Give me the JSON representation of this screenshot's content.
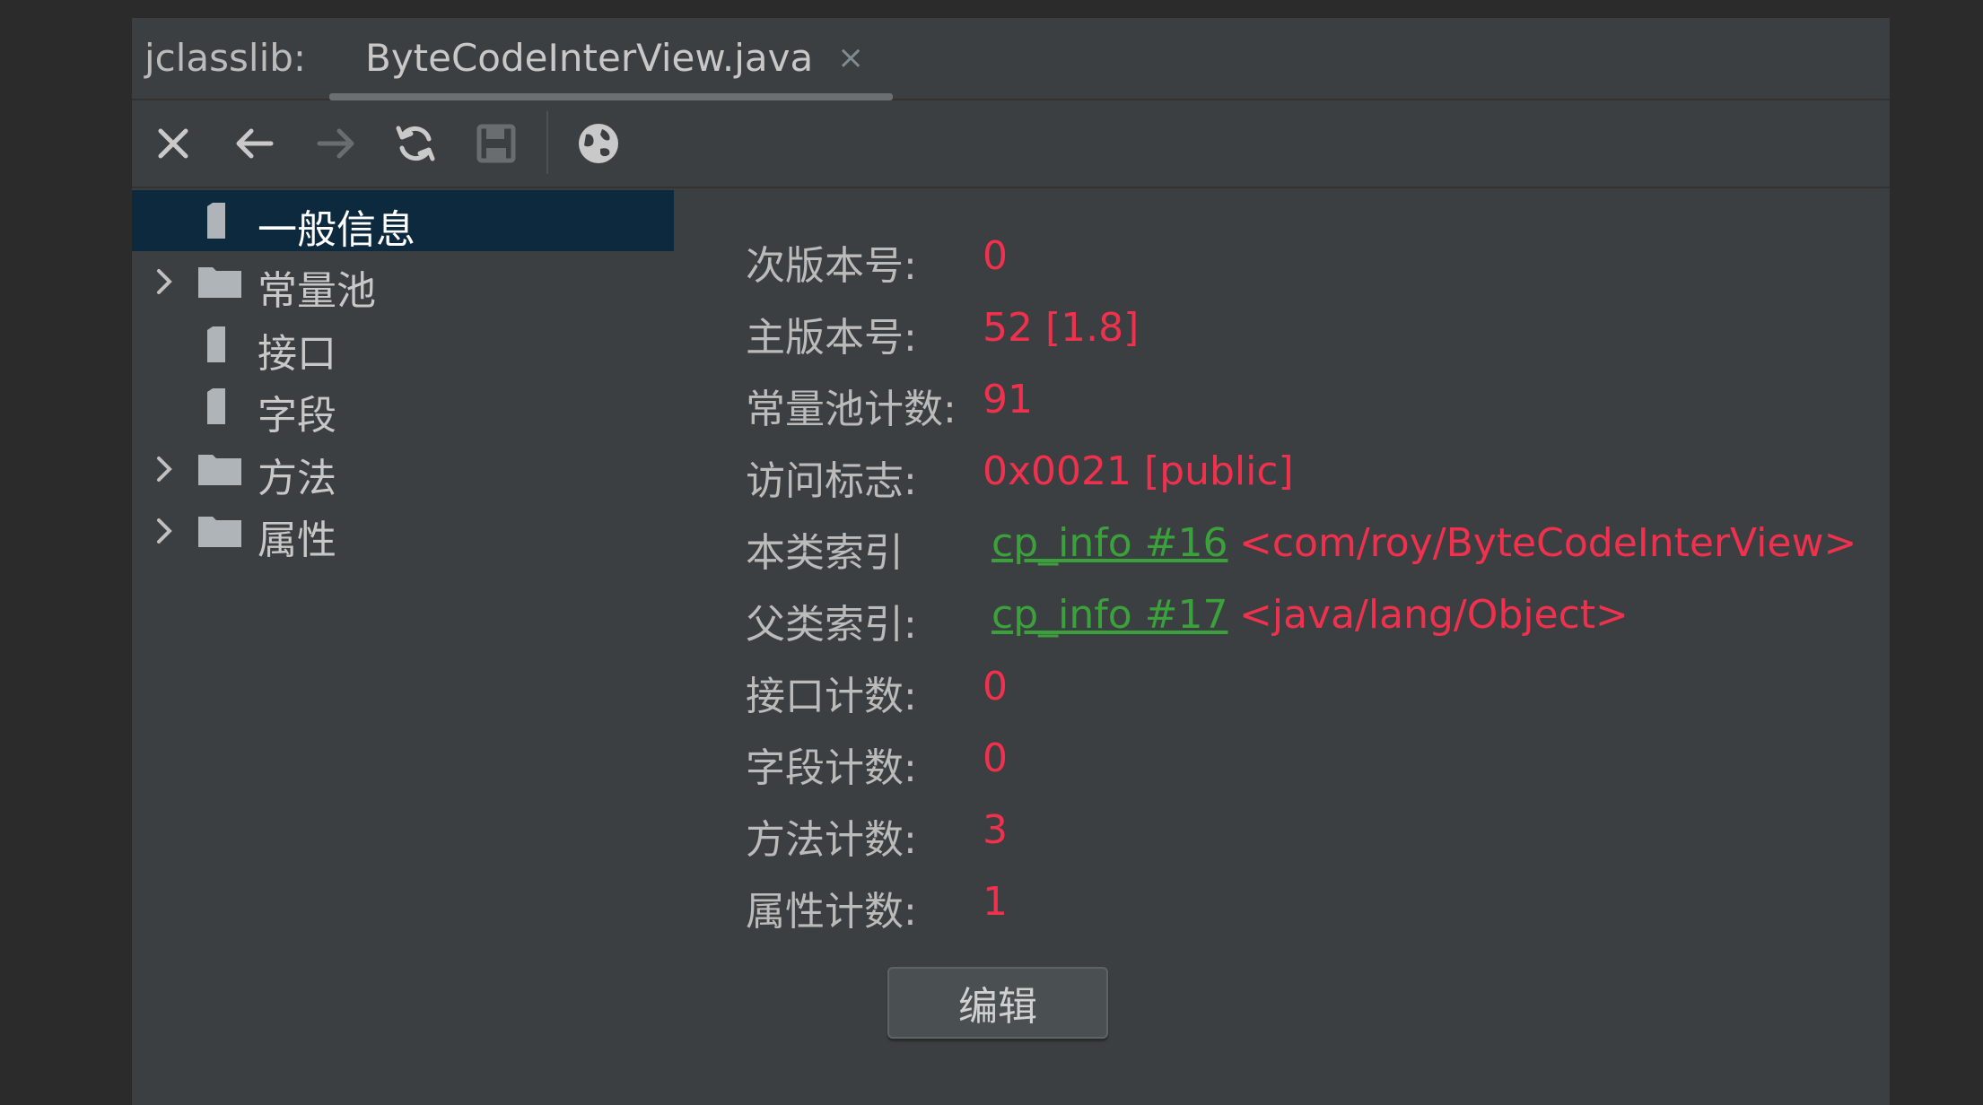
{
  "tab_bar": {
    "tool_title": "jclasslib:",
    "tab_label": "ByteCodeInterView.java",
    "close_glyph": "×"
  },
  "toolbar": {
    "buttons": [
      {
        "icon": "close-icon",
        "enabled": true
      },
      {
        "icon": "back-arrow-icon",
        "enabled": true
      },
      {
        "icon": "forward-arrow-icon",
        "enabled": false
      },
      {
        "icon": "refresh-icon",
        "enabled": true
      },
      {
        "icon": "save-icon",
        "enabled": false
      },
      {
        "icon": "globe-icon",
        "enabled": true
      }
    ]
  },
  "tree": {
    "items": [
      {
        "label": "一般信息",
        "icon": "file-icon",
        "expandable": false,
        "selected": true
      },
      {
        "label": "常量池",
        "icon": "folder-icon",
        "expandable": true,
        "selected": false
      },
      {
        "label": "接口",
        "icon": "file-icon",
        "expandable": false,
        "selected": false
      },
      {
        "label": "字段",
        "icon": "file-icon",
        "expandable": false,
        "selected": false
      },
      {
        "label": "方法",
        "icon": "folder-icon",
        "expandable": true,
        "selected": false
      },
      {
        "label": "属性",
        "icon": "folder-icon",
        "expandable": true,
        "selected": false
      }
    ]
  },
  "details": {
    "minor_version": {
      "label": "次版本号:",
      "value": "0"
    },
    "major_version": {
      "label": "主版本号:",
      "value": "52 [1.8]"
    },
    "constant_pool_count": {
      "label": "常量池计数:",
      "value": "91"
    },
    "access_flags": {
      "label": "访问标志:",
      "value": "0x0021 [public]"
    },
    "this_class": {
      "label": "本类索引",
      "link": "cp_info #16",
      "ref": "<com/roy/ByteCodeInterView>"
    },
    "super_class": {
      "label": "父类索引:",
      "link": "cp_info #17",
      "ref": "<java/lang/Object>"
    },
    "interfaces_count": {
      "label": "接口计数:",
      "value": "0"
    },
    "fields_count": {
      "label": "字段计数:",
      "value": "0"
    },
    "methods_count": {
      "label": "方法计数:",
      "value": "3"
    },
    "attributes_count": {
      "label": "属性计数:",
      "value": "1"
    },
    "edit_label": "编辑"
  },
  "colors": {
    "background": "#3c3f41",
    "selection": "#0d293e",
    "value_red": "#f0314e",
    "link_green": "#3ba13b",
    "label_gray": "#bbbbbb"
  }
}
